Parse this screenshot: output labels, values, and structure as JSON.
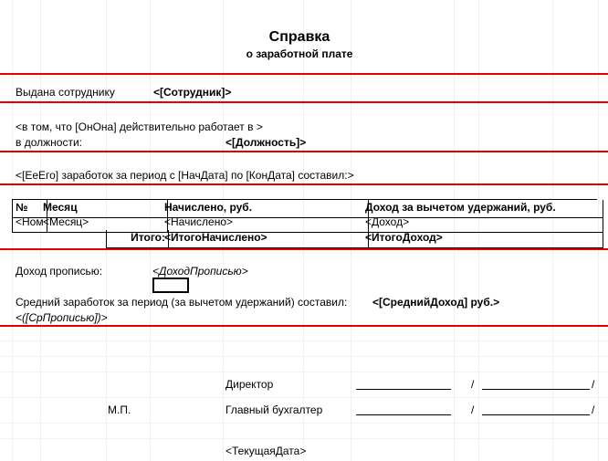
{
  "title": "Справка",
  "subtitle": "о заработной плате",
  "issued_label": "Выдана сотруднику",
  "issued_ph": "<[Сотрудник]>",
  "worksline": "<в том, что [ОнОна] действительно работает в >",
  "position_label": "в должности:",
  "position_ph": "<[Должность]>",
  "earnings_line": "<[ЕеЕго] заработок за период с [НачДата] по  [КонДата] составил:>",
  "tbl": {
    "h_no": "№",
    "h_month": "Месяц",
    "h_acc": "Начислено, руб.",
    "h_inc": "Доход за вычетом удержаний, руб.",
    "r_no": "<Ном",
    "r_month": "<Месяц>",
    "r_acc": "<Начислено>",
    "r_inc": "<Доход>",
    "total_label": "Итого:",
    "total_acc": "<ИтогоНачислено>",
    "total_inc": "<ИтогоДоход>"
  },
  "income_words_label": "Доход прописью:",
  "income_words_ph": "<ДоходПрописью>",
  "avg_label": "Средний заработок за период (за вычетом удержаний) составил:",
  "avg_value": "<[СреднийДоход] руб.>",
  "avg_words": "<([СрПрописью])>",
  "director": "Директор",
  "chief_acc": "Главный бухгалтер",
  "stamp": "М.П.",
  "cur_date": "<ТекущаяДата>",
  "slash": "/"
}
